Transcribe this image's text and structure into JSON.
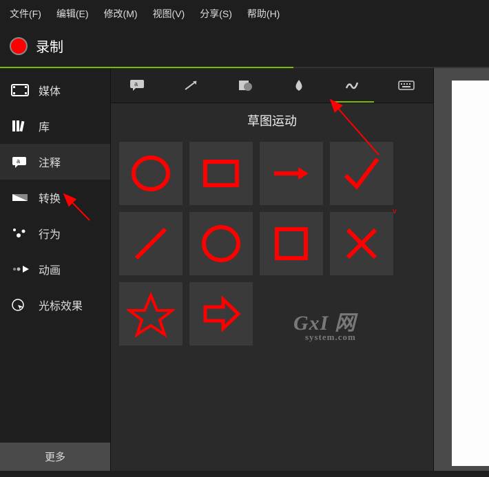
{
  "menu": {
    "file": "文件(F)",
    "edit": "编辑(E)",
    "modify": "修改(M)",
    "view": "视图(V)",
    "share": "分享(S)",
    "help": "帮助(H)"
  },
  "record_label": "录制",
  "sidebar": {
    "items": [
      {
        "label": "媒体"
      },
      {
        "label": "库"
      },
      {
        "label": "注释"
      },
      {
        "label": "转换"
      },
      {
        "label": "行为"
      },
      {
        "label": "动画"
      },
      {
        "label": "光标效果"
      }
    ],
    "more": "更多"
  },
  "panel_title": "草图运动",
  "watermark": {
    "main": "GxI 网",
    "sub": "system.com"
  }
}
